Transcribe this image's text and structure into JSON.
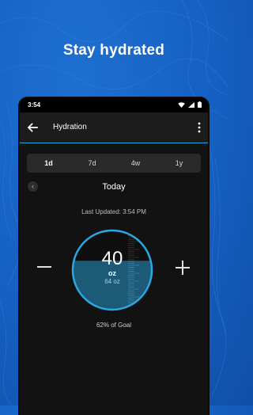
{
  "headline": "Stay hydrated",
  "status_bar": {
    "time": "3:54",
    "icons": [
      "wifi-icon",
      "signal-icon",
      "battery-icon"
    ]
  },
  "app_bar": {
    "title": "Hydration",
    "back_icon": "arrow-left-icon",
    "menu_icon": "more-vert-icon"
  },
  "range_tabs": [
    {
      "label": "1d",
      "selected": true
    },
    {
      "label": "7d",
      "selected": false
    },
    {
      "label": "4w",
      "selected": false
    },
    {
      "label": "1y",
      "selected": false
    }
  ],
  "day_nav": {
    "label": "Today",
    "prev_icon": "chevron-left-icon"
  },
  "last_updated": "Last Updated: 3:54 PM",
  "intake": {
    "amount": "40",
    "unit": "oz",
    "goal": "64 oz",
    "fill_fraction": 0.62
  },
  "goal_progress": "62% of Goal",
  "colors": {
    "background": "#1560c2",
    "accent": "#2aa8e0",
    "water": "#1c5a78",
    "surface": "#121212"
  }
}
